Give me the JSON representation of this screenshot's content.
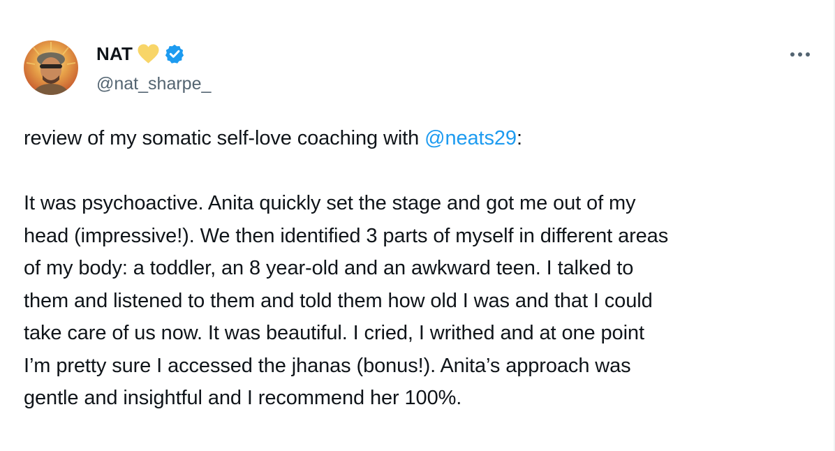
{
  "author": {
    "display_name": "NAT",
    "name_emoji": "yellow-heart-icon",
    "verified_badge": "verified-badge-icon",
    "handle": "@nat_sharpe_"
  },
  "more_menu": {
    "icon": "more-options-icon"
  },
  "tweet": {
    "intro_text": "review of my somatic self-love coaching with ",
    "mention": "@neats29",
    "intro_suffix": ":",
    "lines": [
      "It was psychoactive. Anita quickly set the stage and got me out of my",
      "head (impressive!). We then identified 3 parts of myself in different areas",
      "of my body: a toddler, an 8 year-old and an awkward teen. I talked to",
      "them and listened to them and told them how old I was and that I could",
      "take care of us now. It was beautiful. I cried, I writhed and at one point",
      "I’m pretty sure I accessed the jhanas (bonus!). Anita’s approach was",
      "gentle and insightful and I recommend her 100%."
    ]
  },
  "colors": {
    "text": "#0f1419",
    "secondary": "#536471",
    "link": "#1d9bf0",
    "heart": "#f8d568",
    "verified": "#1d9bf0"
  }
}
